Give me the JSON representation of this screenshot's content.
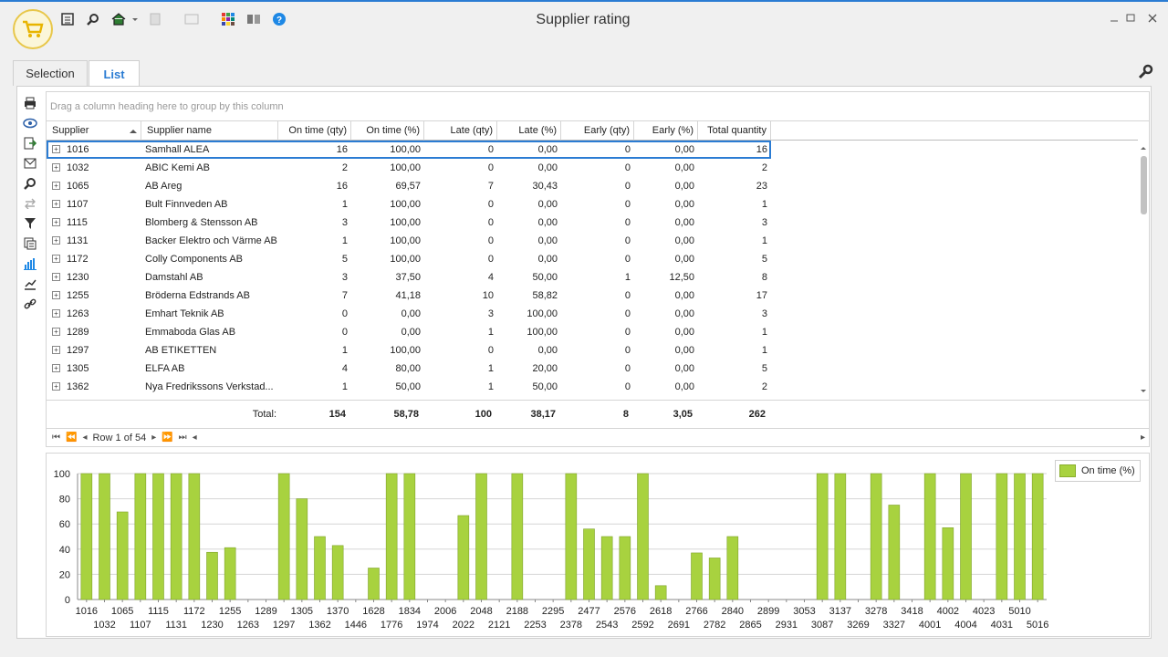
{
  "window": {
    "title": "Supplier rating"
  },
  "tabs": [
    {
      "label": "Selection"
    },
    {
      "label": "List"
    }
  ],
  "grid": {
    "group_hint": "Drag a column heading here to group by this column",
    "columns": [
      "Supplier",
      "Supplier name",
      "On time (qty)",
      "On time (%)",
      "Late (qty)",
      "Late (%)",
      "Early (qty)",
      "Early (%)",
      "Total quantity"
    ],
    "rows": [
      [
        "1016",
        "Samhall ALEA",
        "16",
        "100,00",
        "0",
        "0,00",
        "0",
        "0,00",
        "16"
      ],
      [
        "1032",
        "ABIC Kemi AB",
        "2",
        "100,00",
        "0",
        "0,00",
        "0",
        "0,00",
        "2"
      ],
      [
        "1065",
        "AB Areg",
        "16",
        "69,57",
        "7",
        "30,43",
        "0",
        "0,00",
        "23"
      ],
      [
        "1107",
        "Bult Finnveden AB",
        "1",
        "100,00",
        "0",
        "0,00",
        "0",
        "0,00",
        "1"
      ],
      [
        "1115",
        "Blomberg & Stensson AB",
        "3",
        "100,00",
        "0",
        "0,00",
        "0",
        "0,00",
        "3"
      ],
      [
        "1131",
        "Backer Elektro och Värme AB",
        "1",
        "100,00",
        "0",
        "0,00",
        "0",
        "0,00",
        "1"
      ],
      [
        "1172",
        "Colly Components AB",
        "5",
        "100,00",
        "0",
        "0,00",
        "0",
        "0,00",
        "5"
      ],
      [
        "1230",
        "Damstahl AB",
        "3",
        "37,50",
        "4",
        "50,00",
        "1",
        "12,50",
        "8"
      ],
      [
        "1255",
        "Bröderna Edstrands AB",
        "7",
        "41,18",
        "10",
        "58,82",
        "0",
        "0,00",
        "17"
      ],
      [
        "1263",
        "Emhart Teknik AB",
        "0",
        "0,00",
        "3",
        "100,00",
        "0",
        "0,00",
        "3"
      ],
      [
        "1289",
        "Emmaboda Glas AB",
        "0",
        "0,00",
        "1",
        "100,00",
        "0",
        "0,00",
        "1"
      ],
      [
        "1297",
        "AB ETIKETTEN",
        "1",
        "100,00",
        "0",
        "0,00",
        "0",
        "0,00",
        "1"
      ],
      [
        "1305",
        "ELFA AB",
        "4",
        "80,00",
        "1",
        "20,00",
        "0",
        "0,00",
        "5"
      ],
      [
        "1362",
        "Nya Fredrikssons Verkstad...",
        "1",
        "50,00",
        "1",
        "50,00",
        "0",
        "0,00",
        "2"
      ]
    ],
    "totals": {
      "label": "Total:",
      "on_time_qty": "154",
      "on_time_pct": "58,78",
      "late_qty": "100",
      "late_pct": "38,17",
      "early_qty": "8",
      "early_pct": "3,05",
      "total_qty": "262"
    },
    "pager": {
      "row_text": "Row 1 of 54"
    }
  },
  "chart_data": {
    "type": "bar",
    "series": [
      {
        "name": "On time (%)",
        "color": "#a8d23f"
      }
    ],
    "categories": [
      "1016",
      "1032",
      "1065",
      "1107",
      "1115",
      "1131",
      "1172",
      "1230",
      "1255",
      "1263",
      "1289",
      "1297",
      "1305",
      "1362",
      "1370",
      "1446",
      "1628",
      "1776",
      "1834",
      "1974",
      "2006",
      "2022",
      "2048",
      "2121",
      "2188",
      "2253",
      "2295",
      "2378",
      "2477",
      "2543",
      "2576",
      "2592",
      "2618",
      "2691",
      "2766",
      "2782",
      "2840",
      "2865",
      "2899",
      "2931",
      "3053",
      "3087",
      "3137",
      "3269",
      "3278",
      "3327",
      "3418",
      "4001",
      "4002",
      "4004",
      "4023",
      "4031",
      "5010",
      "5016"
    ],
    "values": [
      100,
      100,
      69.57,
      100,
      100,
      100,
      100,
      37.5,
      41.18,
      0,
      0,
      100,
      80,
      50,
      42.86,
      0,
      25,
      100,
      100,
      0,
      0,
      66.67,
      100,
      0,
      100,
      0,
      0,
      100,
      56,
      50,
      50,
      100,
      11,
      0,
      37,
      33,
      50,
      0,
      0,
      0,
      0,
      100,
      100,
      0,
      100,
      75,
      0,
      100,
      57,
      100,
      0,
      100,
      100,
      100
    ],
    "ylim": [
      0,
      100
    ],
    "yticks": [
      0,
      20,
      40,
      60,
      80,
      100
    ],
    "grid": true,
    "legend": "top-right"
  }
}
